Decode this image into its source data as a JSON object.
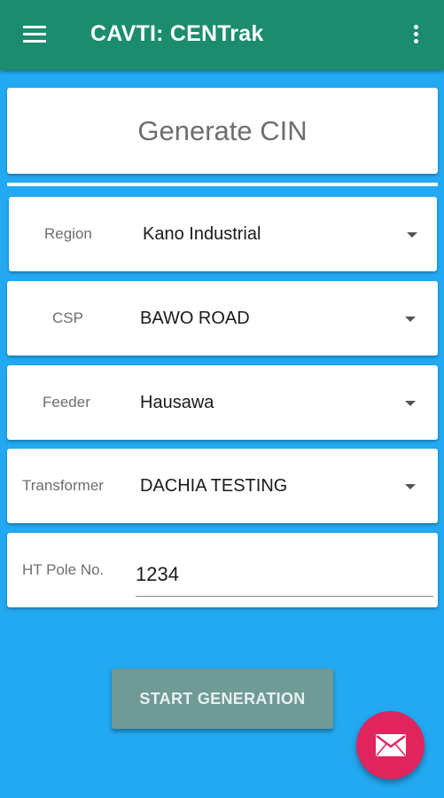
{
  "app_bar": {
    "title": "CAVTI: CENTrak",
    "menu_icon": "hamburger-menu-icon",
    "overflow_icon": "more-vert-icon",
    "color": "#1b8c6e"
  },
  "page": {
    "title": "Generate CIN",
    "background": "#22a9f1"
  },
  "form": {
    "region": {
      "label": "Region",
      "value": "Kano Industrial"
    },
    "csp": {
      "label": "CSP",
      "value": "BAWO ROAD"
    },
    "feeder": {
      "label": "Feeder",
      "value": "Hausawa"
    },
    "transformer": {
      "label": "Transformer",
      "value": "DACHIA TESTING"
    },
    "ht_pole": {
      "label": "HT Pole No.",
      "value": "1234"
    }
  },
  "actions": {
    "start_label": "START GENERATION",
    "fab_icon": "email-icon",
    "fab_color": "#e0245e"
  }
}
